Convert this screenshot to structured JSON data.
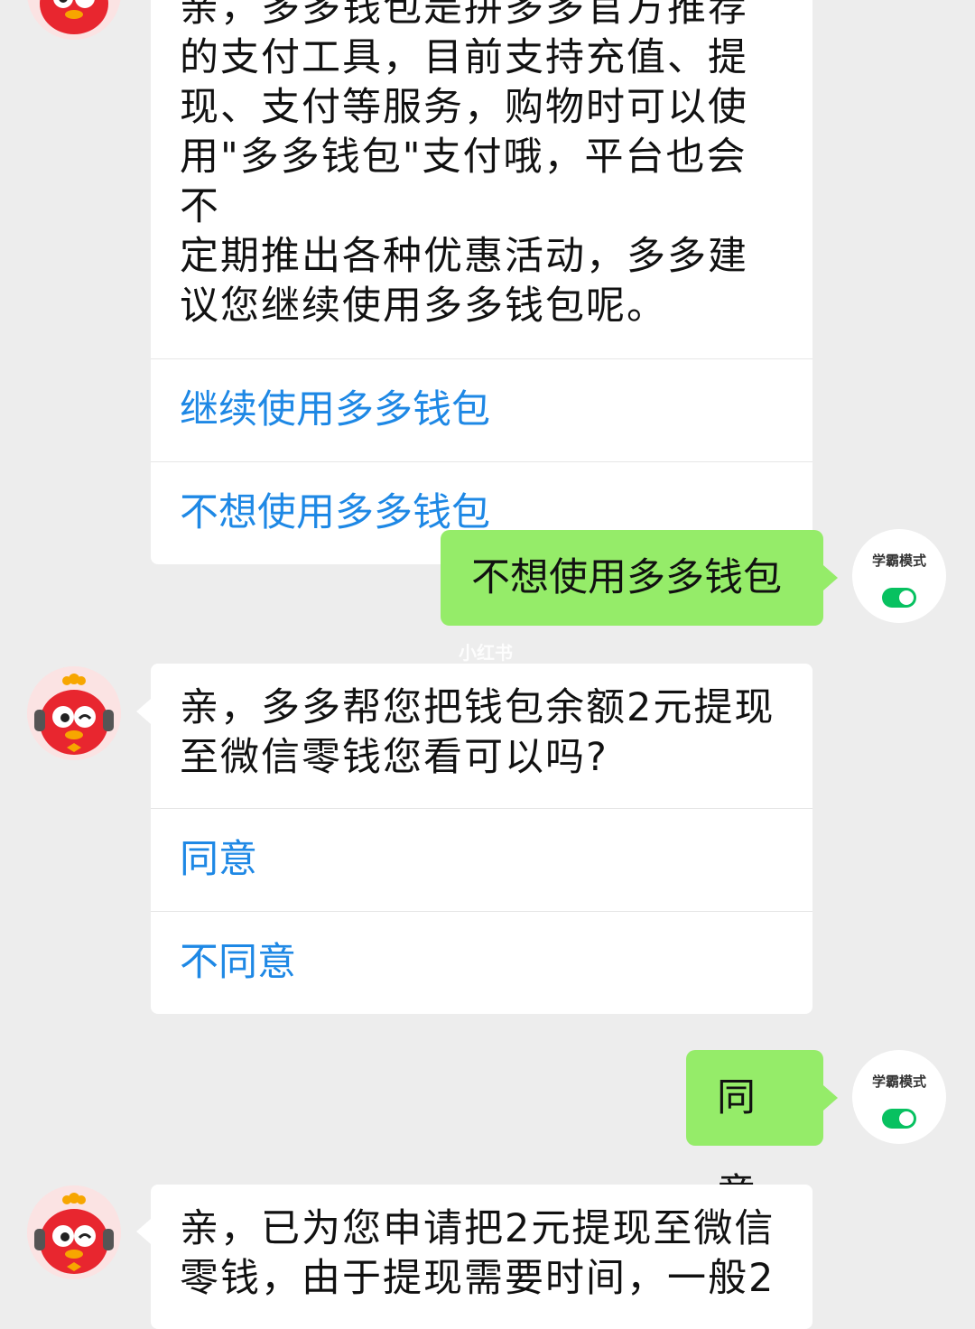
{
  "messages": {
    "bot1": {
      "lines": [
        "亲，多多钱包是拼多多官方推荐",
        "的支付工具，目前支持充值、提",
        "现、支付等服务，购物时可以使",
        "用\"多多钱包\"支付哦，平台也会不",
        "定期推出各种优惠活动，多多建",
        "议您继续使用多多钱包呢。"
      ],
      "options": [
        "继续使用多多钱包",
        "不想使用多多钱包"
      ]
    },
    "user1": "不想使用多多钱包",
    "bot2": {
      "lines": [
        "亲，多多帮您把钱包余额2元提现",
        "至微信零钱您看可以吗?"
      ],
      "options": [
        "同意",
        "不同意"
      ]
    },
    "user2": "同意",
    "bot3": {
      "lines": [
        "亲，已为您申请把2元提现至微信",
        "零钱，由于提现需要时间，一般2"
      ]
    }
  },
  "user_avatar": {
    "label": "学霸模式",
    "toggle_on": true
  },
  "watermark": "小红书",
  "colors": {
    "user_bubble": "#95ec69",
    "option_link": "#1e88e5",
    "toggle": "#07c160"
  }
}
